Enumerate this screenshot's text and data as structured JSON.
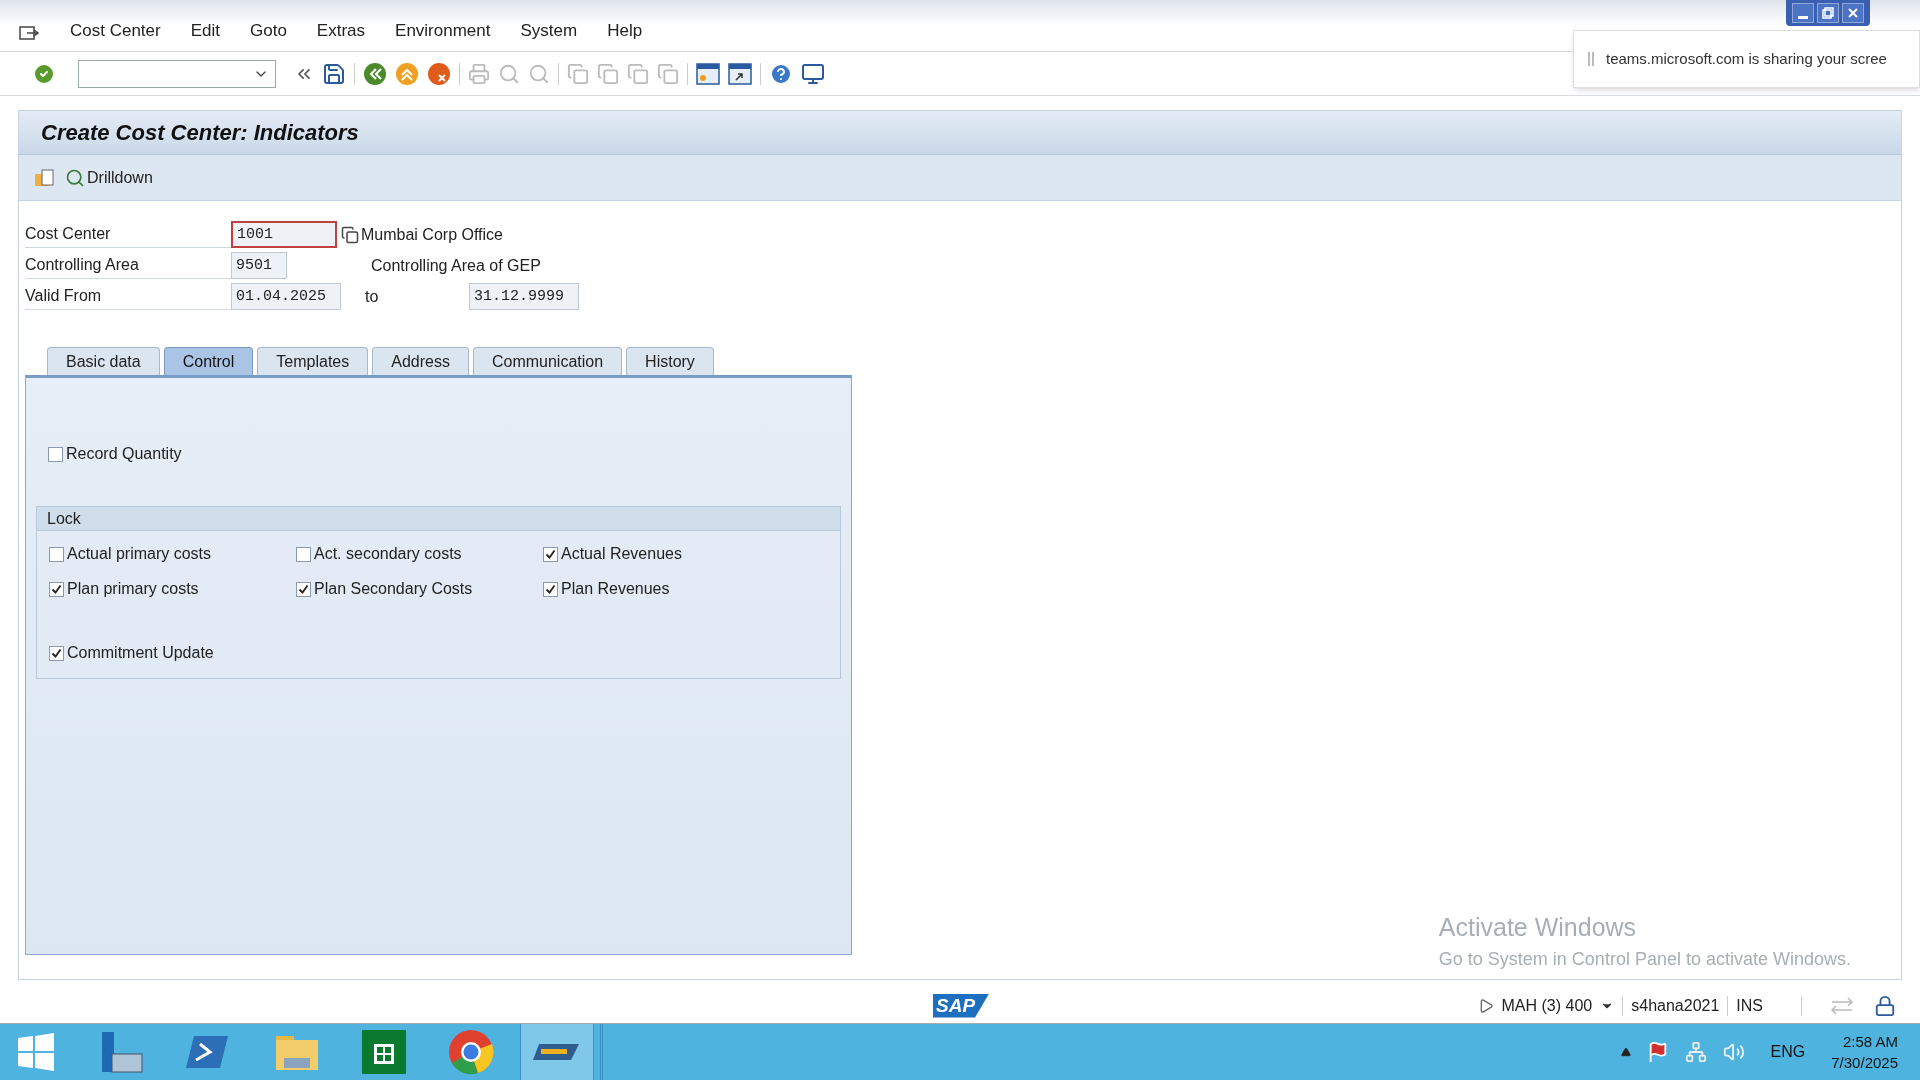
{
  "window": {
    "controls": [
      {
        "kind": "minimize"
      },
      {
        "kind": "restore"
      },
      {
        "kind": "close"
      }
    ]
  },
  "menu": [
    "Cost Center",
    "Edit",
    "Goto",
    "Extras",
    "Environment",
    "System",
    "Help"
  ],
  "notification": {
    "text": "teams.microsoft.com is sharing your scree"
  },
  "title": "Create Cost Center: Indicators",
  "app_toolbar": {
    "drilldown": "Drilldown"
  },
  "fields": [
    {
      "label": "Cost Center",
      "value": "1001",
      "focused": true,
      "description": "Mumbai Corp Office"
    },
    {
      "label": "Controlling Area",
      "value": "9501",
      "focused": false,
      "description": "Controlling Area of GEP"
    },
    {
      "label": "Valid From",
      "value": "01.04.2025",
      "focused": false,
      "to_label": "to",
      "to_value": "31.12.9999"
    }
  ],
  "tabs": [
    {
      "label": "Basic data",
      "selected": false
    },
    {
      "label": "Control",
      "selected": true
    },
    {
      "label": "Templates",
      "selected": false
    },
    {
      "label": "Address",
      "selected": false
    },
    {
      "label": "Communication",
      "selected": false
    },
    {
      "label": "History",
      "selected": false
    }
  ],
  "record_quantity": {
    "label": "Record Quantity",
    "checked": false
  },
  "lock": {
    "title": "Lock",
    "checkboxes": [
      {
        "label": "Actual primary costs",
        "checked": false
      },
      {
        "label": "Act. secondary costs",
        "checked": false
      },
      {
        "label": "Actual Revenues",
        "checked": true
      },
      {
        "label": "Plan primary costs",
        "checked": true
      },
      {
        "label": "Plan Secondary Costs",
        "checked": true
      },
      {
        "label": "Plan Revenues",
        "checked": true
      }
    ]
  },
  "commitment_update": {
    "label": "Commitment Update",
    "checked": true
  },
  "activation_notice": {
    "title": "Activate Windows",
    "text": "Go to System in Control Panel to activate Windows."
  },
  "status_bar": {
    "logo": "SAP",
    "session": "MAH (3) 400",
    "server": "s4hana2021",
    "mode": "INS"
  },
  "taskbar": {
    "language": "ENG",
    "time": "2:58 AM",
    "date": "7/30/2025"
  }
}
